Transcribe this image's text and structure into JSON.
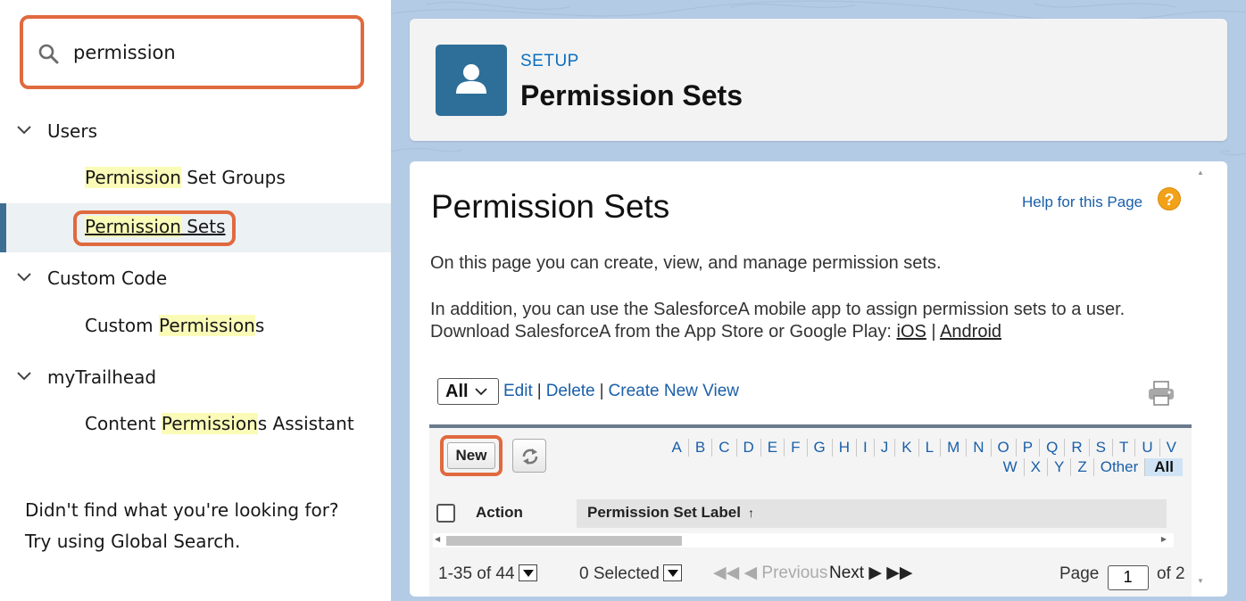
{
  "sidebar": {
    "search": {
      "value": "permission"
    },
    "sections": [
      {
        "label": "Users",
        "items": [
          {
            "highlight": "Permission",
            "rest": " Set Groups"
          },
          {
            "highlight": "Permission",
            "rest": " Sets",
            "selected": true
          }
        ]
      },
      {
        "label": "Custom Code",
        "items": [
          {
            "prefix": "Custom ",
            "highlight": "Permission",
            "rest": "s"
          }
        ]
      },
      {
        "label": "myTrailhead",
        "items": [
          {
            "prefix": "Content ",
            "highlight": "Permission",
            "rest": "s Assistant"
          }
        ]
      }
    ],
    "not_found_line1": "Didn't find what you're looking for?",
    "not_found_line2": "Try using Global Search."
  },
  "header": {
    "setup_label": "SETUP",
    "title": "Permission Sets",
    "icon": "user-icon"
  },
  "content": {
    "page_title": "Permission Sets",
    "help_link": "Help for this Page",
    "help_icon": "?",
    "description": "On this page you can create, view, and manage permission sets.",
    "mobile_line1": "In addition, you can use the SalesforceA mobile app to assign permission sets to a user.",
    "mobile_line2": "Download SalesforceA from the App Store or Google Play: ",
    "ios_link": "iOS",
    "link_separator": "|",
    "android_link": "Android"
  },
  "view": {
    "selected": "All",
    "edit": "Edit",
    "delete": "Delete",
    "create_new_view": "Create New View",
    "separator": "|"
  },
  "list": {
    "new_button": "New",
    "alphabet_row1": [
      "A",
      "B",
      "C",
      "D",
      "E",
      "F",
      "G",
      "H",
      "I",
      "J",
      "K",
      "L",
      "M",
      "N",
      "O",
      "P",
      "Q",
      "R",
      "S",
      "T",
      "U",
      "V"
    ],
    "alphabet_row2": [
      "W",
      "X",
      "Y",
      "Z",
      "Other",
      "All"
    ],
    "active_letter": "All",
    "columns": {
      "action": "Action",
      "label": "Permission Set Label",
      "sort_indicator": "↑"
    }
  },
  "footer": {
    "record_range": "1-35 of 44",
    "selected": "0 Selected",
    "previous": "Previous",
    "next": "Next",
    "page_label": "Page",
    "page_value": "1",
    "page_total": "of 2"
  },
  "colors": {
    "accent_outline": "#e06a3f",
    "link": "#1a5fa8",
    "header_icon_bg": "#2e6f99",
    "search_highlight": "#fbfbb8"
  }
}
